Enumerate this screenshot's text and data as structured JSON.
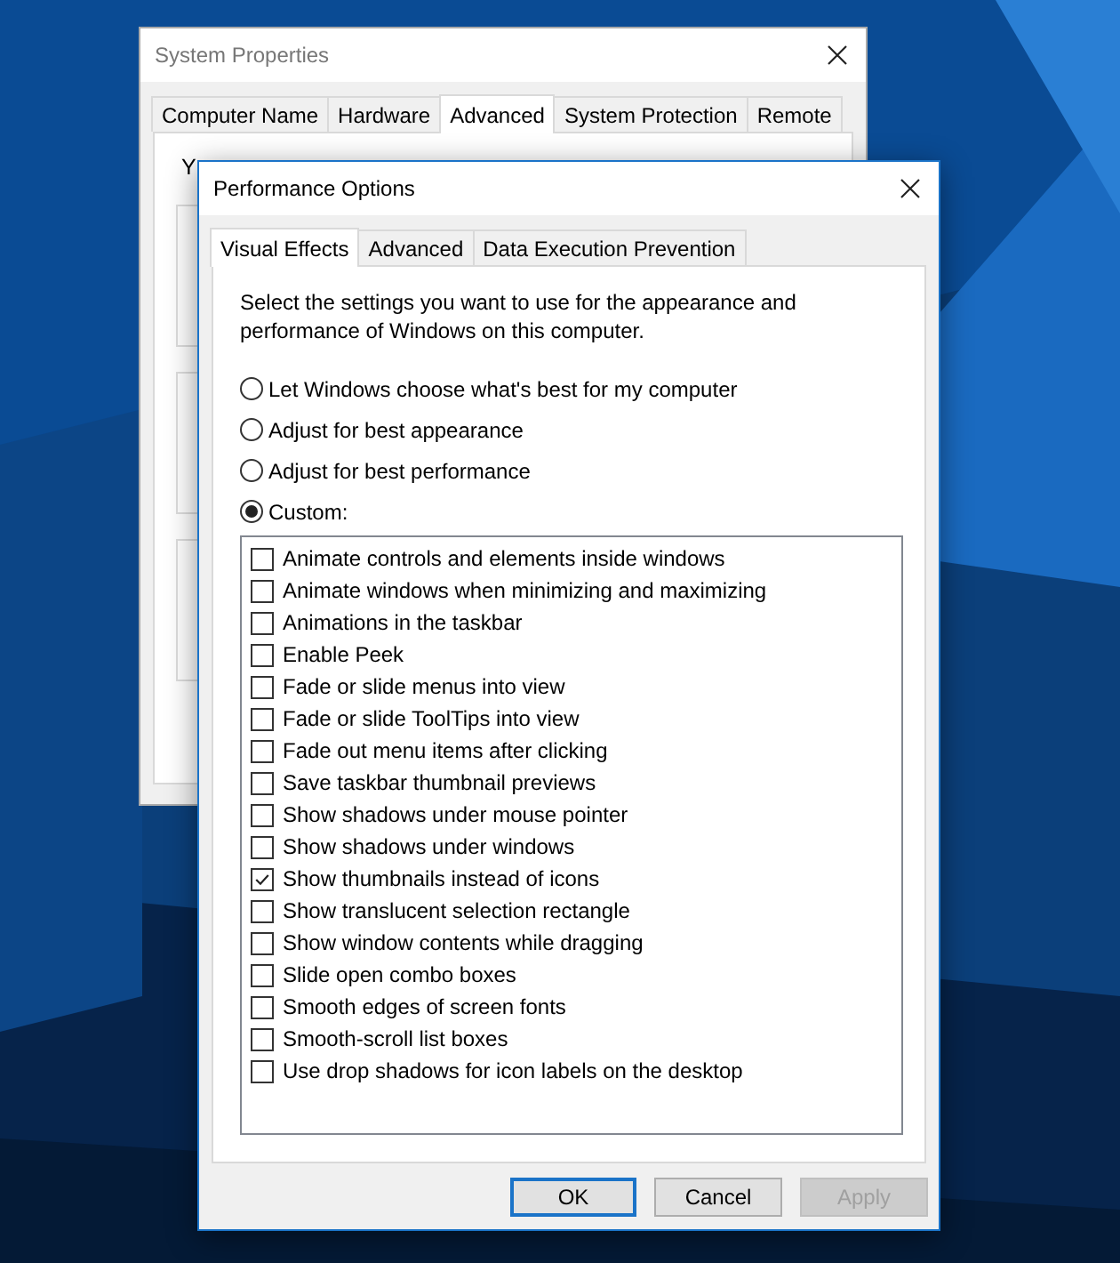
{
  "system_window": {
    "title": "System Properties",
    "tabs": [
      {
        "label": "Computer Name",
        "selected": false
      },
      {
        "label": "Hardware",
        "selected": false
      },
      {
        "label": "Advanced",
        "selected": true
      },
      {
        "label": "System Protection",
        "selected": false
      },
      {
        "label": "Remote",
        "selected": false
      }
    ],
    "visible_text": "Y"
  },
  "performance_window": {
    "title": "Performance Options",
    "tabs": [
      {
        "label": "Visual Effects",
        "selected": true
      },
      {
        "label": "Advanced",
        "selected": false
      },
      {
        "label": "Data Execution Prevention",
        "selected": false
      }
    ],
    "description": "Select the settings you want to use for the appearance and performance of Windows on this computer.",
    "options": [
      {
        "label": "Let Windows choose what's best for my computer",
        "selected": false
      },
      {
        "label": "Adjust for best appearance",
        "selected": false
      },
      {
        "label": "Adjust for best performance",
        "selected": false
      },
      {
        "label": "Custom:",
        "selected": true
      }
    ],
    "effects": [
      {
        "label": "Animate controls and elements inside windows",
        "checked": false
      },
      {
        "label": "Animate windows when minimizing and maximizing",
        "checked": false
      },
      {
        "label": "Animations in the taskbar",
        "checked": false
      },
      {
        "label": "Enable Peek",
        "checked": false
      },
      {
        "label": "Fade or slide menus into view",
        "checked": false
      },
      {
        "label": "Fade or slide ToolTips into view",
        "checked": false
      },
      {
        "label": "Fade out menu items after clicking",
        "checked": false
      },
      {
        "label": "Save taskbar thumbnail previews",
        "checked": false
      },
      {
        "label": "Show shadows under mouse pointer",
        "checked": false
      },
      {
        "label": "Show shadows under windows",
        "checked": false
      },
      {
        "label": "Show thumbnails instead of icons",
        "checked": true
      },
      {
        "label": "Show translucent selection rectangle",
        "checked": false
      },
      {
        "label": "Show window contents while dragging",
        "checked": false
      },
      {
        "label": "Slide open combo boxes",
        "checked": false
      },
      {
        "label": "Smooth edges of screen fonts",
        "checked": false
      },
      {
        "label": "Smooth-scroll list boxes",
        "checked": false
      },
      {
        "label": "Use drop shadows for icon labels on the desktop",
        "checked": false
      }
    ],
    "buttons": [
      {
        "label": "OK",
        "kind": "default"
      },
      {
        "label": "Cancel",
        "kind": "normal"
      },
      {
        "label": "Apply",
        "kind": "disabled"
      }
    ]
  }
}
